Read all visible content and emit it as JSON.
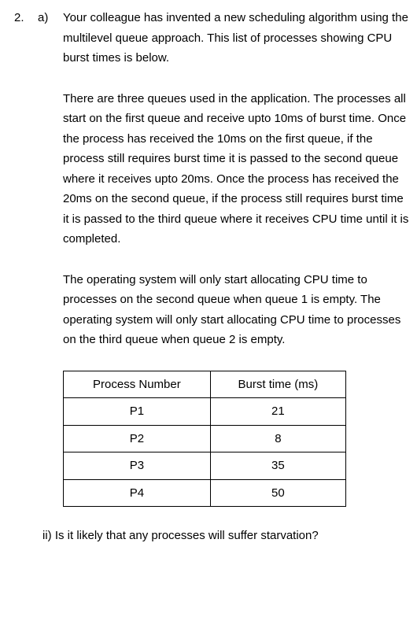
{
  "question": {
    "number": "2.",
    "part": "a)",
    "para1": "Your colleague has invented a new scheduling algorithm using the multilevel queue approach. This list of processes showing CPU burst times is below.",
    "para2": "There are three queues used in the application.  The processes all start on the first queue and receive upto 10ms of burst time.  Once the process has received the 10ms on the first queue, if the process still requires burst time it is passed to the second queue where it receives upto 20ms.  Once the process has received the 20ms on the second queue, if the process still requires burst time it is passed to the third queue where it receives CPU time until it is completed.",
    "para3": "The operating system will only start allocating CPU time to processes on the second queue when queue 1 is empty. The operating system will only start allocating CPU time to processes on the third queue when queue 2 is empty.",
    "table": {
      "headers": {
        "col1": "Process Number",
        "col2": "Burst time (ms)"
      },
      "rows": [
        {
          "process": "P1",
          "burst": "21"
        },
        {
          "process": "P2",
          "burst": "8"
        },
        {
          "process": "P3",
          "burst": "35"
        },
        {
          "process": "P4",
          "burst": "50"
        }
      ]
    },
    "subpart_ii": "ii) Is it likely that any processes will suffer starvation?"
  }
}
